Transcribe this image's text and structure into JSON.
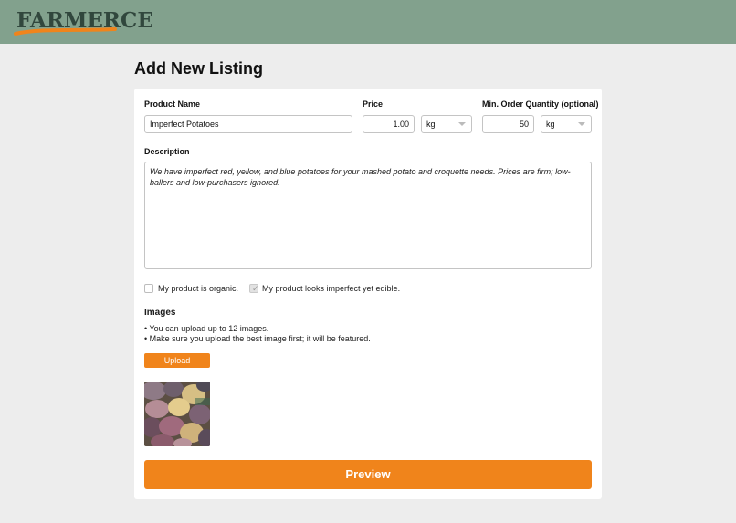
{
  "header": {
    "logo_text": "FARMERCE",
    "background": "#82a18d",
    "logo_color": "#31473d",
    "accent": "#f0841b"
  },
  "page": {
    "title": "Add New Listing"
  },
  "form": {
    "product_name": {
      "label": "Product Name",
      "value": "Imperfect Potatoes"
    },
    "price": {
      "label": "Price",
      "value": "1.00",
      "unit": "kg"
    },
    "min_order": {
      "label": "Min. Order Quantity (optional)",
      "value": "50",
      "unit": "kg"
    },
    "description": {
      "label": "Description",
      "value": "We have imperfect red, yellow, and blue potatoes for your mashed potato and croquette needs. Prices are firm; low-ballers and low-purchasers ignored."
    },
    "organic_checkbox": {
      "label": "My product is organic.",
      "checked": false
    },
    "imperfect_checkbox": {
      "label": "My product looks imperfect yet edible.",
      "checked": true
    }
  },
  "images": {
    "title": "Images",
    "hints": [
      "• You can upload up to 12 images.",
      "• Make sure you upload the best image first; it will be featured."
    ],
    "upload_label": "Upload",
    "thumbnail_icon": "potatoes-photo"
  },
  "actions": {
    "preview_label": "Preview"
  }
}
